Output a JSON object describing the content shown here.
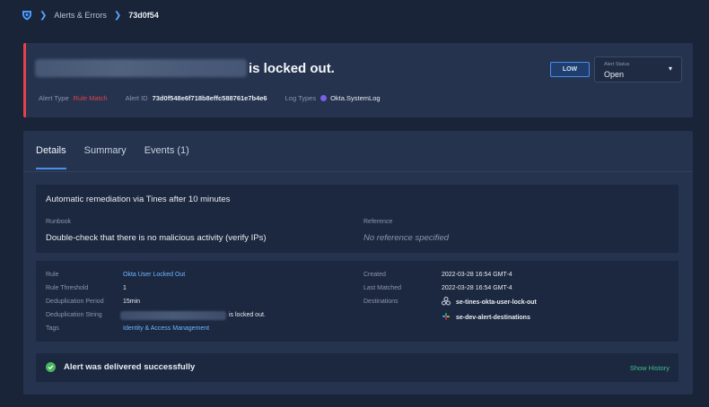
{
  "breadcrumb": {
    "logo_icon": "shield-logo-icon",
    "items": [
      "Alerts & Errors",
      "73d0f54"
    ]
  },
  "alert": {
    "title_suffix": "is locked out.",
    "meta": {
      "type_label": "Alert Type",
      "type_value": "Rule Match",
      "id_label": "Alert ID",
      "id_value": "73d0f548e6f718b8effc588761e7b4e6",
      "log_label": "Log Types",
      "log_value": "Okta.SystemLog"
    },
    "severity": "LOW",
    "status": {
      "label": "Alert Status",
      "value": "Open"
    },
    "colors": {
      "accent_red": "#e2434b",
      "link_blue": "#6fb6ff",
      "success_green": "#48b85c"
    }
  },
  "tabs": [
    "Details",
    "Summary",
    "Events (1)"
  ],
  "remediation": {
    "text": "Automatic remediation via Tines after 10 minutes",
    "runbook_label": "Runbook",
    "runbook_value": "Double-check that there is no malicious activity (verify IPs)",
    "reference_label": "Reference",
    "reference_value": "No reference specified"
  },
  "rule": {
    "rule_label": "Rule",
    "rule_value": "Okta User Locked Out",
    "threshold_label": "Rule Threshold",
    "threshold_value": "1",
    "dedup_period_label": "Deduplication Period",
    "dedup_period_value": "15min",
    "dedup_string_label": "Deduplication String",
    "dedup_string_suffix": "is locked out.",
    "tags_label": "Tags",
    "tags_value": "Identity & Access Management",
    "created_label": "Created",
    "created_value": "2022-03-28 16:54 GMT-4",
    "matched_label": "Last Matched",
    "matched_value": "2022-03-28 16:54 GMT-4",
    "destinations_label": "Destinations",
    "destinations": [
      "se-tines-okta-user-lock-out",
      "se-dev-alert-destinations"
    ]
  },
  "delivery": {
    "message": "Alert was delivered successfully",
    "history_link": "Show History"
  }
}
